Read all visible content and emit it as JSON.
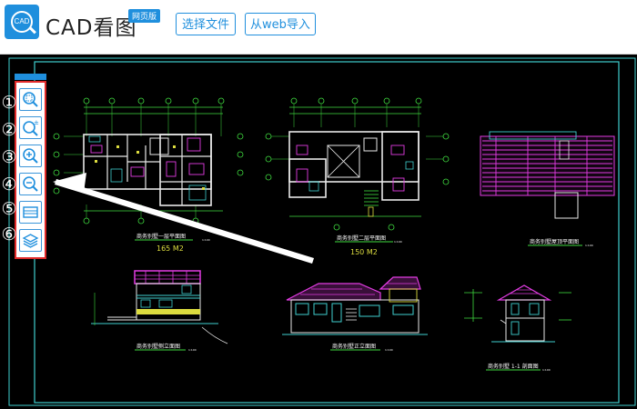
{
  "header": {
    "title": "CAD看图",
    "badge": "网页版",
    "logo_text": "CAD",
    "buttons": {
      "select_file": "选择文件",
      "import_web": "从web导入"
    }
  },
  "toolbar": {
    "numbers": [
      "①",
      "②",
      "③",
      "④",
      "⑤",
      "⑥"
    ],
    "tools": [
      {
        "icon": "zoom-window-icon"
      },
      {
        "icon": "zoom-realtime-icon"
      },
      {
        "icon": "zoom-in-icon"
      },
      {
        "icon": "zoom-out-icon"
      },
      {
        "icon": "fit-extents-icon"
      },
      {
        "icon": "layers-icon"
      }
    ]
  },
  "drawing": {
    "captions": {
      "plan1": "商务别墅一层平面图",
      "plan1_area": "165 M2",
      "plan2": "商务别墅二层平面图",
      "plan2_area": "150 M2",
      "roof": "商务别墅屋顶平面图",
      "side": "商务别墅侧立面图",
      "front": "商务别墅正立面图",
      "section": "商务别墅 1-1 剖面图"
    },
    "scales": {
      "plan1": "1:100",
      "plan2": "1:100",
      "roof": "1:100",
      "side": "1:100",
      "front": "1:100",
      "section": "1:100"
    }
  }
}
